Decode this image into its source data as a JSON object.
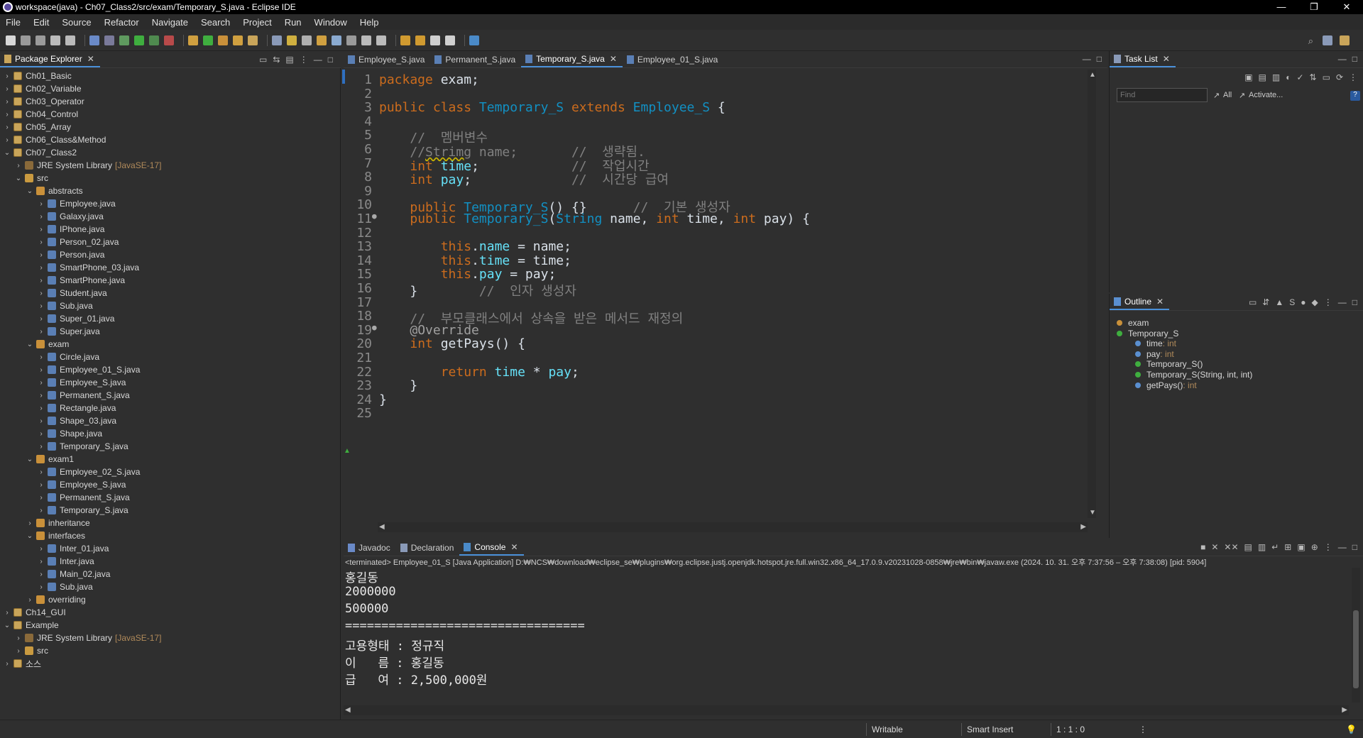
{
  "window": {
    "title": "workspace(java) - Ch07_Class2/src/exam/Temporary_S.java - Eclipse IDE",
    "controls": [
      "—",
      "❐",
      "✕"
    ]
  },
  "menu": [
    "File",
    "Edit",
    "Source",
    "Refactor",
    "Navigate",
    "Search",
    "Project",
    "Run",
    "Window",
    "Help"
  ],
  "package_explorer": {
    "title": "Package Explorer",
    "items": [
      {
        "label": "Ch01_Basic",
        "type": "project",
        "level": 0,
        "expanded": false
      },
      {
        "label": "Ch02_Variable",
        "type": "project",
        "level": 0,
        "expanded": false
      },
      {
        "label": "Ch03_Operator",
        "type": "project",
        "level": 0,
        "expanded": false
      },
      {
        "label": "Ch04_Control",
        "type": "project",
        "level": 0,
        "expanded": false
      },
      {
        "label": "Ch05_Array",
        "type": "project",
        "level": 0,
        "expanded": false
      },
      {
        "label": "Ch06_Class&Method",
        "type": "project",
        "level": 0,
        "expanded": false
      },
      {
        "label": "Ch07_Class2",
        "type": "project",
        "level": 0,
        "expanded": true
      },
      {
        "label": "JRE System Library",
        "deco": "[JavaSE-17]",
        "type": "lib",
        "level": 1,
        "expanded": false
      },
      {
        "label": "src",
        "type": "src",
        "level": 1,
        "expanded": true
      },
      {
        "label": "abstracts",
        "type": "pkg",
        "level": 2,
        "expanded": true
      },
      {
        "label": "Employee.java",
        "type": "java",
        "level": 3,
        "expanded": false
      },
      {
        "label": "Galaxy.java",
        "type": "java",
        "level": 3,
        "expanded": false
      },
      {
        "label": "IPhone.java",
        "type": "java",
        "level": 3,
        "expanded": false
      },
      {
        "label": "Person_02.java",
        "type": "java",
        "level": 3,
        "expanded": false
      },
      {
        "label": "Person.java",
        "type": "java",
        "level": 3,
        "expanded": false
      },
      {
        "label": "SmartPhone_03.java",
        "type": "java",
        "level": 3,
        "expanded": false
      },
      {
        "label": "SmartPhone.java",
        "type": "java",
        "level": 3,
        "expanded": false
      },
      {
        "label": "Student.java",
        "type": "java",
        "level": 3,
        "expanded": false
      },
      {
        "label": "Sub.java",
        "type": "java",
        "level": 3,
        "expanded": false
      },
      {
        "label": "Super_01.java",
        "type": "java",
        "level": 3,
        "expanded": false
      },
      {
        "label": "Super.java",
        "type": "java",
        "level": 3,
        "expanded": false
      },
      {
        "label": "exam",
        "type": "pkg",
        "level": 2,
        "expanded": true
      },
      {
        "label": "Circle.java",
        "type": "java",
        "level": 3,
        "expanded": false
      },
      {
        "label": "Employee_01_S.java",
        "type": "java",
        "level": 3,
        "expanded": false
      },
      {
        "label": "Employee_S.java",
        "type": "java",
        "level": 3,
        "expanded": false
      },
      {
        "label": "Permanent_S.java",
        "type": "java",
        "level": 3,
        "expanded": false
      },
      {
        "label": "Rectangle.java",
        "type": "java",
        "level": 3,
        "expanded": false
      },
      {
        "label": "Shape_03.java",
        "type": "java",
        "level": 3,
        "expanded": false
      },
      {
        "label": "Shape.java",
        "type": "java",
        "level": 3,
        "expanded": false
      },
      {
        "label": "Temporary_S.java",
        "type": "java",
        "level": 3,
        "expanded": false
      },
      {
        "label": "exam1",
        "type": "pkg",
        "level": 2,
        "expanded": true
      },
      {
        "label": "Employee_02_S.java",
        "type": "java",
        "level": 3,
        "expanded": false
      },
      {
        "label": "Employee_S.java",
        "type": "java",
        "level": 3,
        "expanded": false
      },
      {
        "label": "Permanent_S.java",
        "type": "java",
        "level": 3,
        "expanded": false
      },
      {
        "label": "Temporary_S.java",
        "type": "java",
        "level": 3,
        "expanded": false
      },
      {
        "label": "inheritance",
        "type": "pkg",
        "level": 2,
        "expanded": false
      },
      {
        "label": "interfaces",
        "type": "pkg",
        "level": 2,
        "expanded": true
      },
      {
        "label": "Inter_01.java",
        "type": "java",
        "level": 3,
        "expanded": false
      },
      {
        "label": "Inter.java",
        "type": "java",
        "level": 3,
        "expanded": false
      },
      {
        "label": "Main_02.java",
        "type": "java",
        "level": 3,
        "expanded": false
      },
      {
        "label": "Sub.java",
        "type": "java",
        "level": 3,
        "expanded": false
      },
      {
        "label": "overriding",
        "type": "pkg",
        "level": 2,
        "expanded": false
      },
      {
        "label": "Ch14_GUI",
        "type": "project",
        "level": 0,
        "expanded": false
      },
      {
        "label": "Example",
        "type": "project",
        "level": 0,
        "expanded": true
      },
      {
        "label": "JRE System Library",
        "deco": "[JavaSE-17]",
        "type": "lib",
        "level": 1,
        "expanded": false
      },
      {
        "label": "src",
        "type": "src",
        "level": 1,
        "expanded": false
      },
      {
        "label": "소스",
        "type": "project",
        "level": 0,
        "expanded": false
      }
    ]
  },
  "editor": {
    "tabs": [
      {
        "label": "Employee_S.java",
        "active": false
      },
      {
        "label": "Permanent_S.java",
        "active": false
      },
      {
        "label": "Temporary_S.java",
        "active": true
      },
      {
        "label": "Employee_01_S.java",
        "active": false
      }
    ],
    "lines": [
      {
        "n": "1",
        "m": "",
        "h": "<span class=\"kw\">package</span> exam;"
      },
      {
        "n": "2",
        "m": "",
        "h": ""
      },
      {
        "n": "3",
        "m": "",
        "h": "<span class=\"kw\">public</span> <span class=\"kw\">class</span> <span class=\"ty\">Temporary_S</span> <span class=\"kw\">extends</span> <span class=\"ty\">Employee_S</span> {"
      },
      {
        "n": "4",
        "m": "",
        "h": ""
      },
      {
        "n": "5",
        "m": "",
        "h": "    <span class=\"cm\">//  멤버변수</span>"
      },
      {
        "n": "6",
        "m": "",
        "h": "    <span class=\"cm\">//<span class=\"sq\">Strimg</span> name;       //  생략됨.</span>"
      },
      {
        "n": "7",
        "m": "",
        "h": "    <span class=\"kw\">int</span> <span class=\"fd\">time</span>;            <span class=\"cm\">//  작업시간</span>"
      },
      {
        "n": "8",
        "m": "",
        "h": "    <span class=\"kw\">int</span> <span class=\"fd\">pay</span>;             <span class=\"cm\">//  시간당 급여</span>"
      },
      {
        "n": "9",
        "m": "",
        "h": ""
      },
      {
        "n": "10",
        "m": "",
        "h": "    <span class=\"kw\">public</span> <span class=\"ty\">Temporary_S</span>() {}      <span class=\"cm\">//  기본 생성자</span>"
      },
      {
        "n": "11",
        "m": "●",
        "h": "    <span class=\"kw\">public</span> <span class=\"ty\">Temporary_S</span>(<span class=\"ty\">String</span> name, <span class=\"kw\">int</span> time, <span class=\"kw\">int</span> pay) {"
      },
      {
        "n": "12",
        "m": "",
        "h": ""
      },
      {
        "n": "13",
        "m": "",
        "h": "        <span class=\"kw\">this</span>.<span class=\"fd\">name</span> = name;"
      },
      {
        "n": "14",
        "m": "",
        "h": "        <span class=\"kw\">this</span>.<span class=\"fd\">time</span> = time;"
      },
      {
        "n": "15",
        "m": "",
        "h": "        <span class=\"kw\">this</span>.<span class=\"fd\">pay</span> = pay;"
      },
      {
        "n": "16",
        "m": "",
        "h": "    }        <span class=\"cm\">//  인자 생성자</span>"
      },
      {
        "n": "17",
        "m": "",
        "h": ""
      },
      {
        "n": "18",
        "m": "",
        "h": "    <span class=\"cm\">//  부모클래스에서 상속을 받은 메서드 재정의</span>"
      },
      {
        "n": "19",
        "m": "●",
        "h": "    <span class=\"an\">@Override</span>"
      },
      {
        "n": "20",
        "m": "",
        "h": "    <span class=\"kw\">int</span> getPays() {"
      },
      {
        "n": "21",
        "m": "",
        "h": ""
      },
      {
        "n": "22",
        "m": "",
        "h": "        <span class=\"kw\">return</span> <span class=\"fd\">time</span> * <span class=\"fd\">pay</span>;"
      },
      {
        "n": "23",
        "m": "",
        "h": "    }"
      },
      {
        "n": "24",
        "m": "",
        "h": "}"
      },
      {
        "n": "25",
        "m": "",
        "h": ""
      }
    ]
  },
  "task_list": {
    "title": "Task List",
    "find_placeholder": "Find",
    "all_label": "All",
    "activate_label": "Activate..."
  },
  "outline": {
    "title": "Outline",
    "items": [
      {
        "label": "exam",
        "type": "",
        "level": 0,
        "icon": "#c9903a"
      },
      {
        "label": "Temporary_S",
        "type": "",
        "level": 0,
        "icon": "#3fae3f"
      },
      {
        "label": "time",
        "type": " : int",
        "level": 1,
        "icon": "#5a8fd0"
      },
      {
        "label": "pay",
        "type": " : int",
        "level": 1,
        "icon": "#5a8fd0"
      },
      {
        "label": "Temporary_S()",
        "type": "",
        "level": 1,
        "icon": "#3fae3f"
      },
      {
        "label": "Temporary_S(String, int, int)",
        "type": "",
        "level": 1,
        "icon": "#3fae3f"
      },
      {
        "label": "getPays()",
        "type": " : int",
        "level": 1,
        "icon": "#5a8fd0"
      }
    ]
  },
  "console": {
    "tabs": [
      {
        "label": "Javadoc",
        "active": false
      },
      {
        "label": "Declaration",
        "active": false
      },
      {
        "label": "Console",
        "active": true
      }
    ],
    "header": "<terminated> Employee_01_S [Java Application] D:₩NCS₩download₩eclipse_se₩plugins₩org.eclipse.justj.openjdk.hotspot.jre.full.win32.x86_64_17.0.9.v20231028-0858₩jre₩bin₩javaw.exe  (2024. 10. 31. 오후 7:37:56 – 오후 7:38:08) [pid: 5904]",
    "lines": [
      "홍길동",
      "2000000",
      "500000",
      "=================================",
      "고용형태 : 정규직",
      "이   름 : 홍길동",
      "급   여 : 2,500,000원"
    ]
  },
  "status": {
    "writable": "Writable",
    "insert_mode": "Smart Insert",
    "position": "1 : 1 : 0"
  }
}
